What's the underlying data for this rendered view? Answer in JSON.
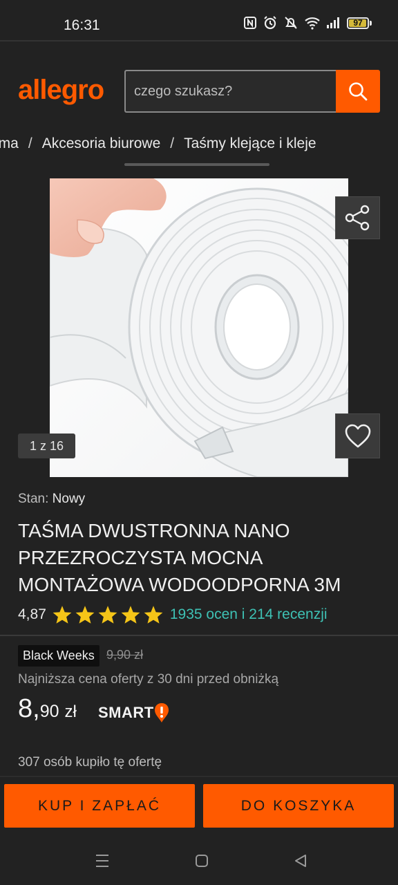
{
  "status_bar": {
    "time": "16:31",
    "battery_percent": "97",
    "icons": [
      "nfc-icon",
      "alarm-icon",
      "mute-icon",
      "wifi-icon",
      "signal-icon",
      "battery-icon"
    ]
  },
  "header": {
    "logo": "allegro",
    "search_placeholder": "czego szukasz?"
  },
  "breadcrumb": [
    "ama",
    "Akcesoria biurowe",
    "Taśmy klejące i kleje"
  ],
  "gallery": {
    "counter": "1 z 16"
  },
  "product": {
    "condition_label": "Stan:",
    "condition_value": "Nowy",
    "title": "TAŚMA DWUSTRONNA NANO PRZEZROCZYSTA MOCNA MONTAŻOWA WODOODPORNA 3M",
    "rating": "4,87",
    "stars": 5,
    "reviews": "1935 ocen i 214 recenzji"
  },
  "pricing": {
    "badge": "Black Weeks",
    "old_price": "9,90 zł",
    "lowest_price_note": "Najniższa cena oferty z 30 dni przed obniżką",
    "price_main": "8,",
    "price_cents": "90",
    "currency": "zł",
    "smart_label": "SMART",
    "bought_count": "307 osób kupiło tę ofertę"
  },
  "actions": {
    "buy_label": "KUP I ZAPŁAĆ",
    "cart_label": "DO KOSZYKA"
  },
  "colors": {
    "brand": "#ff5a00",
    "background": "#222222",
    "link": "#3ec1b4",
    "star": "#f5c518"
  }
}
